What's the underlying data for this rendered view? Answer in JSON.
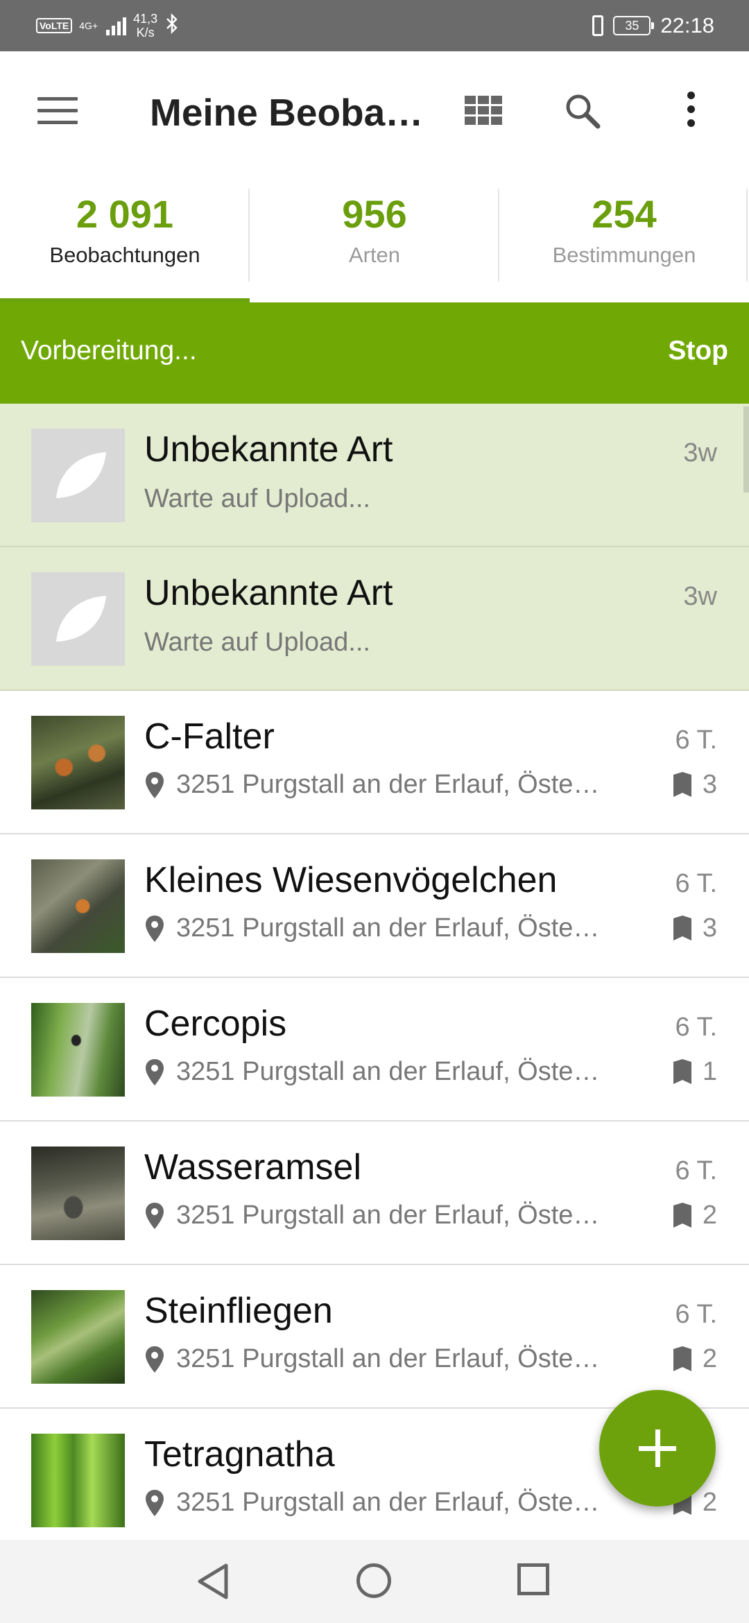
{
  "status_bar": {
    "volte": "VoLTE",
    "network": "4G+",
    "speed_value": "41,3",
    "speed_unit": "K/s",
    "battery": "35",
    "time": "22:18"
  },
  "app_bar": {
    "title": "Meine Beoba…",
    "icons": [
      "menu-icon",
      "grid-view-icon",
      "search-icon",
      "more-options-icon"
    ]
  },
  "stats": [
    {
      "value": "2 091",
      "label": "Beobachtungen",
      "active": true
    },
    {
      "value": "956",
      "label": "Arten",
      "active": false
    },
    {
      "value": "254",
      "label": "Bestimmungen",
      "active": false
    }
  ],
  "sync": {
    "text": "Vorbereitung...",
    "stop_label": "Stop"
  },
  "pending": [
    {
      "name": "Unbekannte Art",
      "status": "Warte auf Upload...",
      "age": "3w"
    },
    {
      "name": "Unbekannte Art",
      "status": "Warte auf Upload...",
      "age": "3w"
    }
  ],
  "observations": [
    {
      "name": "C-Falter",
      "location": "3251 Purgstall an der Erlauf, Öste…",
      "age": "6 T.",
      "count": "3"
    },
    {
      "name": "Kleines Wiesenvögelchen",
      "location": "3251 Purgstall an der Erlauf, Öste…",
      "age": "6 T.",
      "count": "3"
    },
    {
      "name": "Cercopis",
      "location": "3251 Purgstall an der Erlauf, Öste…",
      "age": "6 T.",
      "count": "1"
    },
    {
      "name": "Wasseramsel",
      "location": "3251 Purgstall an der Erlauf, Öste…",
      "age": "6 T.",
      "count": "2"
    },
    {
      "name": "Steinfliegen",
      "location": "3251 Purgstall an der Erlauf, Öste…",
      "age": "6 T.",
      "count": "2"
    },
    {
      "name": "Tetragnatha",
      "location": "3251 Purgstall an der Erlauf, Öste…",
      "age": "",
      "count": "2"
    }
  ],
  "colors": {
    "accent": "#70a906",
    "stat_number": "#6a9e0c",
    "pending_row": "#e3ecd0"
  }
}
